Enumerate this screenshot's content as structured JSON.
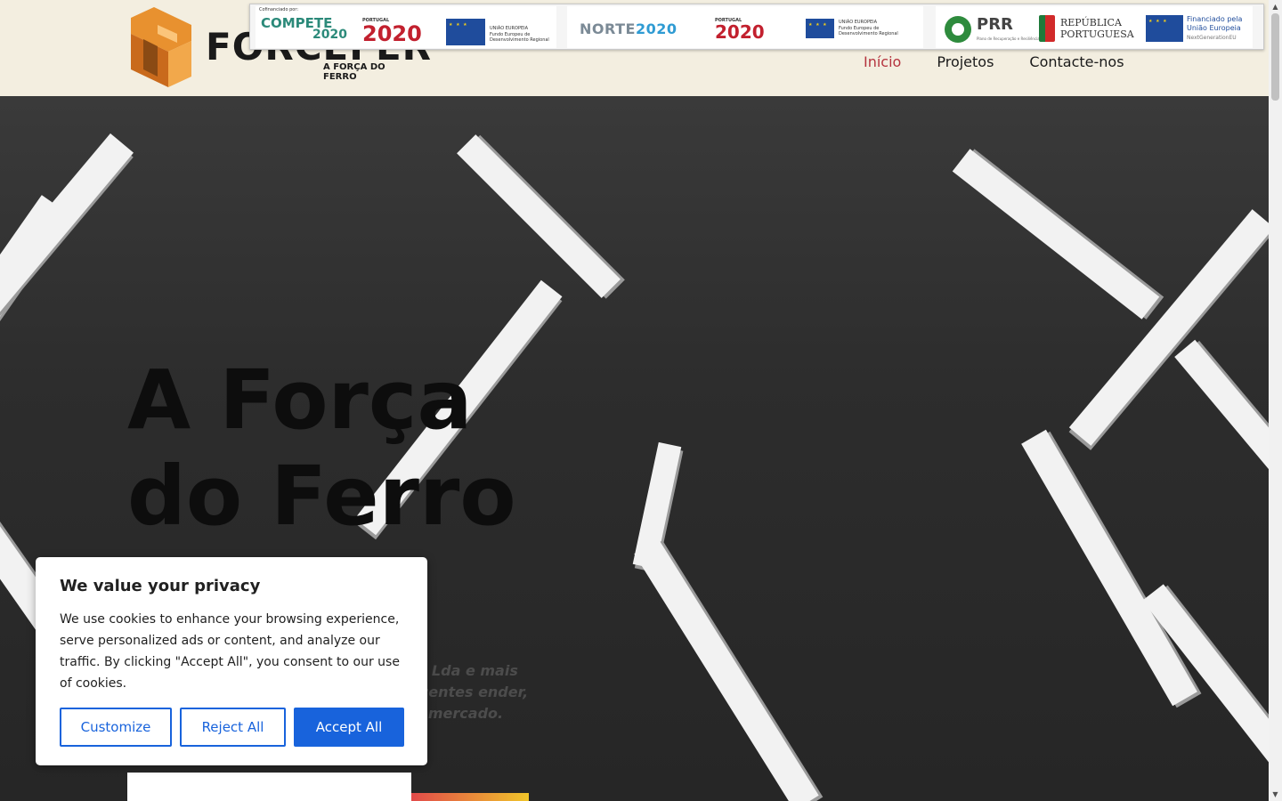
{
  "logo": {
    "word": "FORCEFER",
    "tagline": "A FORÇA DO FERRO"
  },
  "nav": {
    "items": [
      "Início",
      "Projetos",
      "Contacte-nos"
    ]
  },
  "funding": {
    "cofinanciado": "Cofinanciado por:",
    "compete": "COMPETE",
    "compete_year": "2020",
    "portugal": "PORTUGAL",
    "year_2020": "2020",
    "uniao_europeia": "UNIÃO EUROPEIA",
    "fundo_europeu": "Fundo Europeu de Desenvolvimento Regional",
    "norte": "NORTE",
    "norte_year": "2020",
    "prr": "PRR",
    "prr_sub": "Plano de Recuperação e Resiliência",
    "republica": "REPÚBLICA",
    "portuguesa": "PORTUGUESA",
    "financiado": "Financiado pela",
    "financiado_ue": "União Europeia",
    "nextgen": "NextGenerationEU"
  },
  "hero": {
    "title": "A Força do Ferro",
    "paragraph": "ca, Lda e mais recentes ender, de mercado."
  },
  "cookie": {
    "title": "We value your privacy",
    "text": "We use cookies to enhance your browsing experience, serve personalized ads or content, and analyze our traffic. By clicking \"Accept All\", you consent to our use of cookies.",
    "customize": "Customize",
    "reject": "Reject All",
    "accept": "Accept All"
  },
  "colors": {
    "header_bg": "#f3eee0",
    "nav_active": "#b5333e",
    "accent": "#1863dc",
    "logo_orange": "#d9782a"
  },
  "icons": {
    "logo_mark": "forcefer-logo-icon",
    "eu_flag": "eu-flag-icon",
    "scroll_up": "scroll-up-arrow-icon",
    "scroll_down": "scroll-down-arrow-icon"
  }
}
